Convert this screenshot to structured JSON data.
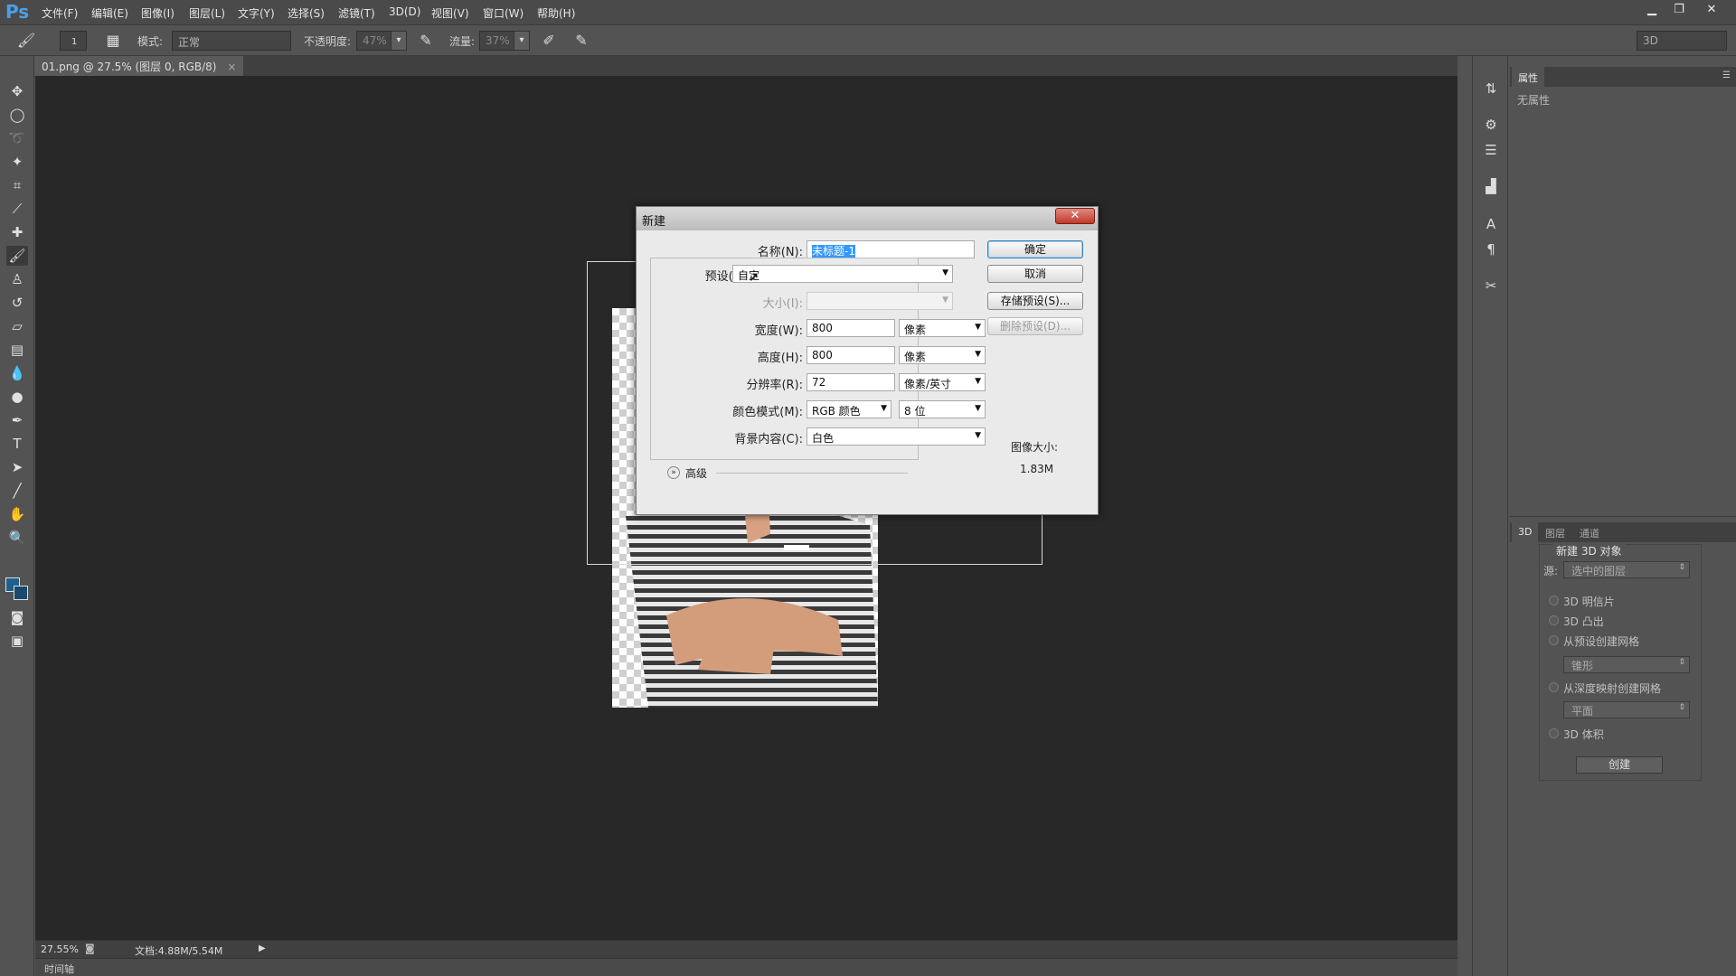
{
  "app": {
    "logo": "Ps"
  },
  "menu": [
    "文件(F)",
    "编辑(E)",
    "图像(I)",
    "图层(L)",
    "文字(Y)",
    "选择(S)",
    "滤镜(T)",
    "3D(D)",
    "视图(V)",
    "窗口(W)",
    "帮助(H)"
  ],
  "window_controls": {
    "minimize": "▁",
    "restore": "❐",
    "close": "✕"
  },
  "options_bar": {
    "brush_size": "1",
    "mode_label": "模式:",
    "mode_value": "正常",
    "opacity_label": "不透明度:",
    "opacity_value": "47%",
    "flow_label": "流量:",
    "flow_value": "37%",
    "workspace": "3D"
  },
  "document_tab": {
    "title": "01.png @ 27.5% (图层 0, RGB/8)",
    "close": "×"
  },
  "status": {
    "zoom": "27.55%",
    "doc_info": "文档:4.88M/5.54M",
    "arrow": "▶"
  },
  "timeline": {
    "label": "时间轴"
  },
  "properties_panel": {
    "tab": "属性",
    "empty_text": "无属性"
  },
  "panel_3d": {
    "tabs": [
      "3D",
      "图层",
      "通道"
    ],
    "title": "新建 3D 对象",
    "source_label": "源:",
    "source_value": "选中的图层",
    "options": [
      "3D 明信片",
      "3D 凸出",
      "从预设创建网格"
    ],
    "preset_value": "锥形",
    "depth_option": "从深度映射创建网格",
    "depth_value": "平面",
    "volume_option": "3D 体积",
    "create_button": "创建"
  },
  "dialog": {
    "title": "新建",
    "close": "✕",
    "name_label": "名称(N):",
    "name_value": "未标题-1",
    "preset_label": "预设(P):",
    "preset_value": "自定",
    "size_label": "大小(I):",
    "width_label": "宽度(W):",
    "width_value": "800",
    "width_unit": "像素",
    "height_label": "高度(H):",
    "height_value": "800",
    "height_unit": "像素",
    "resolution_label": "分辨率(R):",
    "resolution_value": "72",
    "resolution_unit": "像素/英寸",
    "color_mode_label": "颜色模式(M):",
    "color_mode_value": "RGB 颜色",
    "bit_depth_value": "8 位",
    "background_label": "背景内容(C):",
    "background_value": "白色",
    "advanced_label": "高级",
    "ok_button": "确定",
    "cancel_button": "取消",
    "save_preset_button": "存储预设(S)...",
    "delete_preset_button": "删除预设(D)...",
    "image_size_label": "图像大小:",
    "image_size_value": "1.83M"
  }
}
